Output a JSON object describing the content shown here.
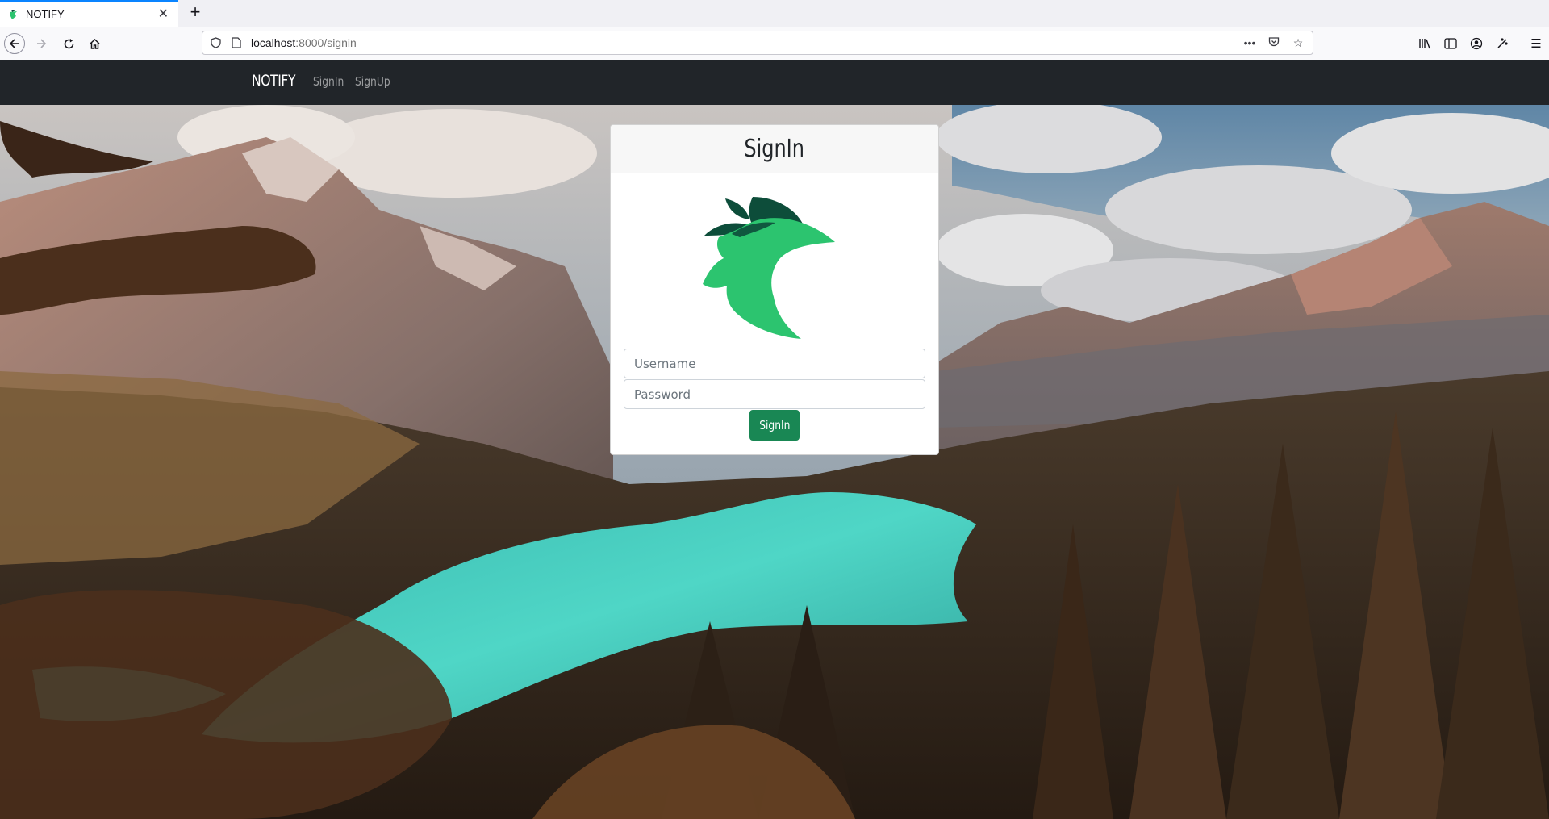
{
  "browser": {
    "tab_title": "NOTIFY",
    "url_host": "localhost",
    "url_rest": ":8000/signin",
    "new_tab_label": "+"
  },
  "site": {
    "brand": "NOTIFY",
    "nav_links": [
      "SignIn",
      "SignUp"
    ]
  },
  "signin": {
    "title": "SignIn",
    "username_placeholder": "Username",
    "password_placeholder": "Password",
    "submit_label": "SignIn"
  },
  "colors": {
    "navbar": "#212529",
    "button": "#198754",
    "logo_light": "#2cc46f",
    "logo_dark": "#0d4d3a"
  },
  "icons": {
    "favicon": "bird-logo-icon",
    "back": "arrow-left-icon",
    "forward": "arrow-right-icon",
    "reload": "reload-icon",
    "home": "home-icon",
    "library": "library-icon",
    "sidebar": "sidebar-icon",
    "account": "account-icon",
    "extensions": "extension-icon",
    "menu": "hamburger-menu-icon"
  }
}
